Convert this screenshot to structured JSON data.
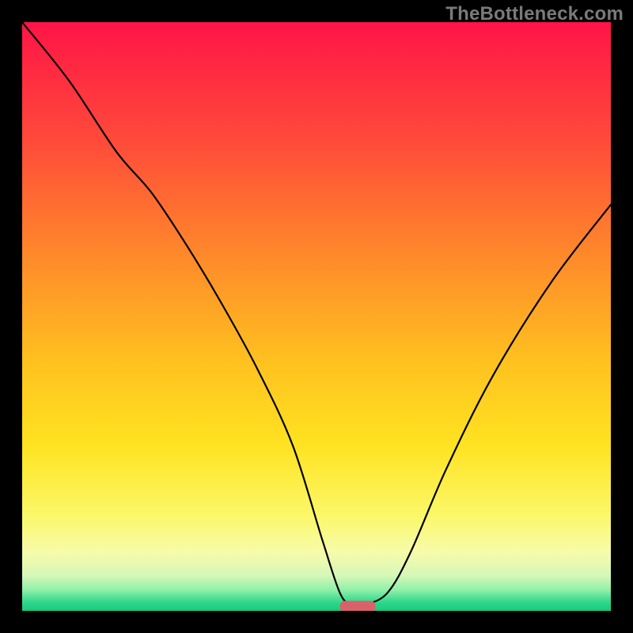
{
  "watermark": "TheBottleneck.com",
  "chart_data": {
    "type": "line",
    "title": "",
    "xlabel": "",
    "ylabel": "",
    "xlim": [
      0,
      100
    ],
    "ylim": [
      0,
      100
    ],
    "grid": false,
    "legend": false,
    "series": [
      {
        "name": "bottleneck-curve",
        "x": [
          0,
          8,
          16,
          22,
          28,
          34,
          40,
          46,
          51,
          54,
          56,
          58,
          62,
          66,
          72,
          80,
          90,
          100
        ],
        "values": [
          100,
          90,
          78,
          71,
          62,
          52,
          41,
          28,
          12,
          3,
          1,
          1,
          3,
          10,
          24,
          40,
          56,
          69
        ]
      }
    ],
    "marker": {
      "name": "optimal-point",
      "x_center": 57,
      "y": 0.7,
      "width": 6,
      "height": 2,
      "color": "#d9616a"
    },
    "gradient_stops": [
      {
        "offset": 0.0,
        "color": "#ff1447"
      },
      {
        "offset": 0.2,
        "color": "#ff4a3a"
      },
      {
        "offset": 0.4,
        "color": "#ff8a2a"
      },
      {
        "offset": 0.58,
        "color": "#ffc21f"
      },
      {
        "offset": 0.72,
        "color": "#ffe321"
      },
      {
        "offset": 0.84,
        "color": "#fbf86a"
      },
      {
        "offset": 0.9,
        "color": "#f7fbaa"
      },
      {
        "offset": 0.94,
        "color": "#d6f7b8"
      },
      {
        "offset": 0.965,
        "color": "#8ef0a8"
      },
      {
        "offset": 0.985,
        "color": "#2fd88b"
      },
      {
        "offset": 1.0,
        "color": "#17c97d"
      }
    ]
  }
}
